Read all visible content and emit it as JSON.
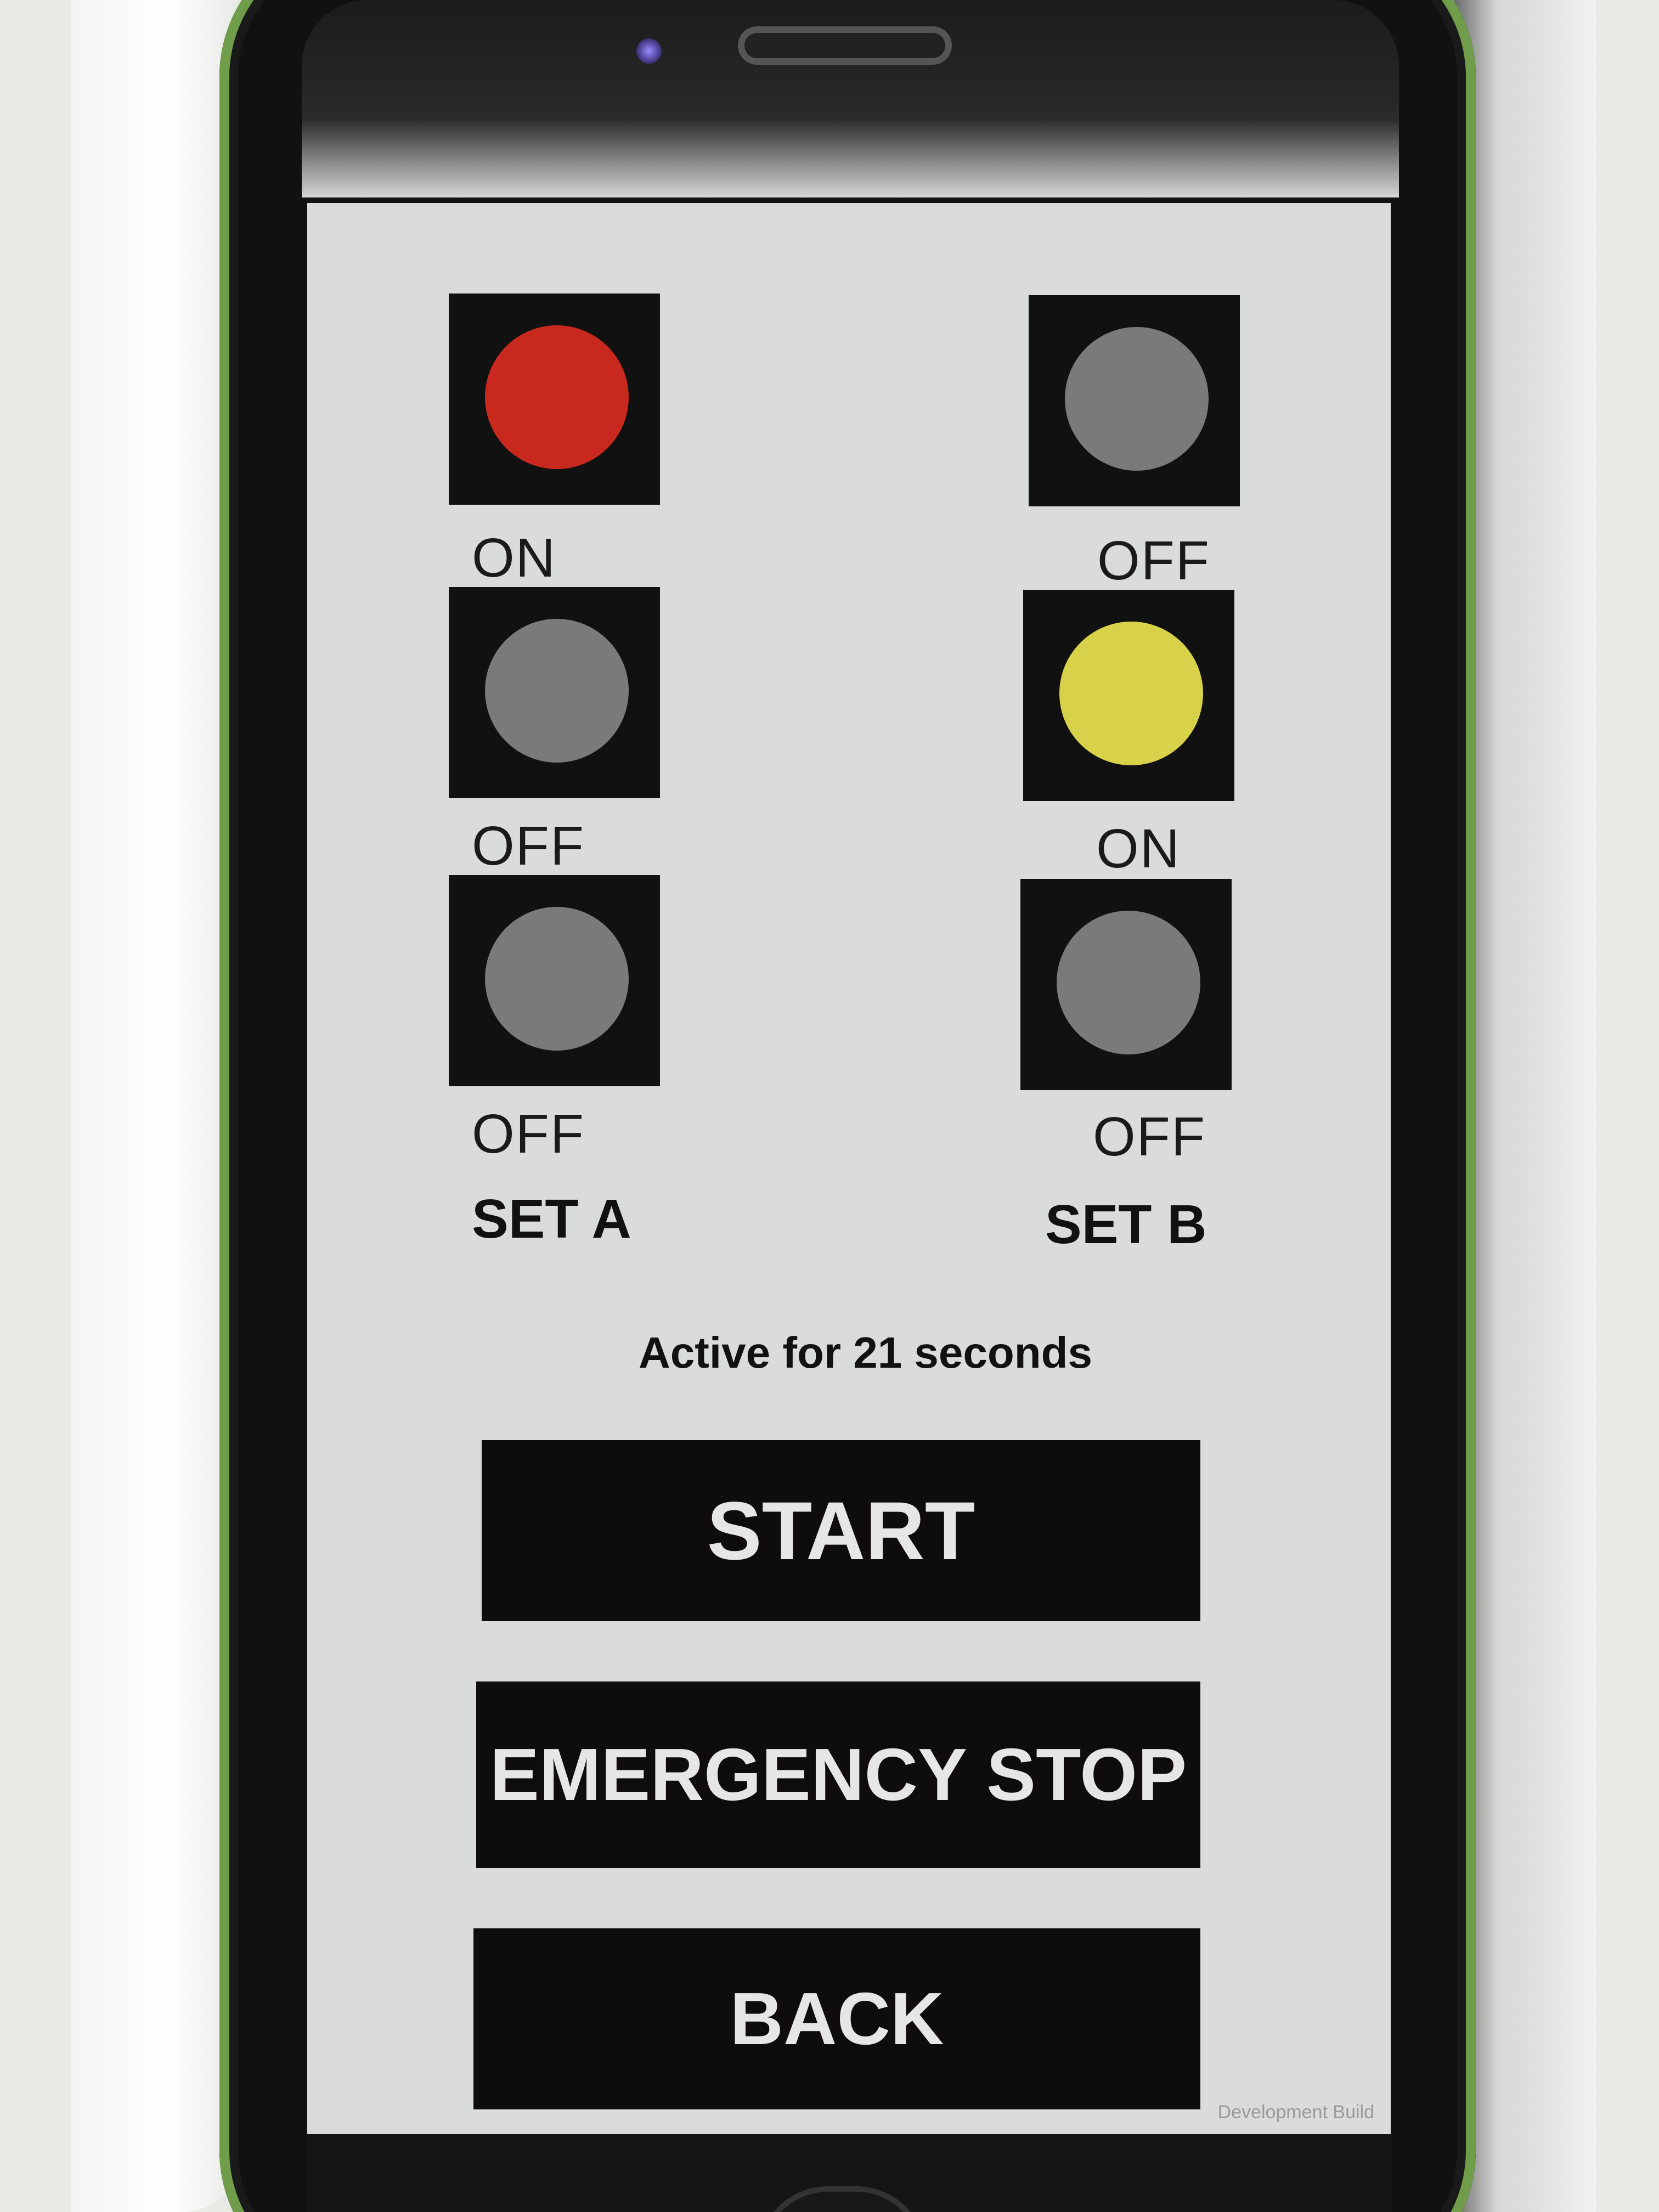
{
  "set_a": {
    "title": "SET A",
    "lamps": [
      {
        "label": "ON",
        "state": "on",
        "color": "#c8281e"
      },
      {
        "label": "OFF",
        "state": "off",
        "color": "#7a7a7a"
      },
      {
        "label": "OFF",
        "state": "off",
        "color": "#7a7a7a"
      }
    ]
  },
  "set_b": {
    "title": "SET B",
    "lamps": [
      {
        "label": "OFF",
        "state": "off",
        "color": "#7a7a7a"
      },
      {
        "label": "ON",
        "state": "on",
        "color": "#d8d24a"
      },
      {
        "label": "OFF",
        "state": "off",
        "color": "#7a7a7a"
      }
    ]
  },
  "status": {
    "text": "Active for 21 seconds"
  },
  "buttons": {
    "start": "START",
    "emergency_stop": "EMERGENCY STOP",
    "back": "BACK"
  },
  "footer": {
    "dev_build": "Development Build"
  },
  "colors": {
    "screen_bg": "#d9dcda",
    "button_bg": "#0f0c0d",
    "button_text": "#e6e6e6",
    "lamp_off": "#7a7a7a",
    "lamp_on_red": "#c8281e",
    "lamp_on_yellow": "#d8d24a"
  }
}
